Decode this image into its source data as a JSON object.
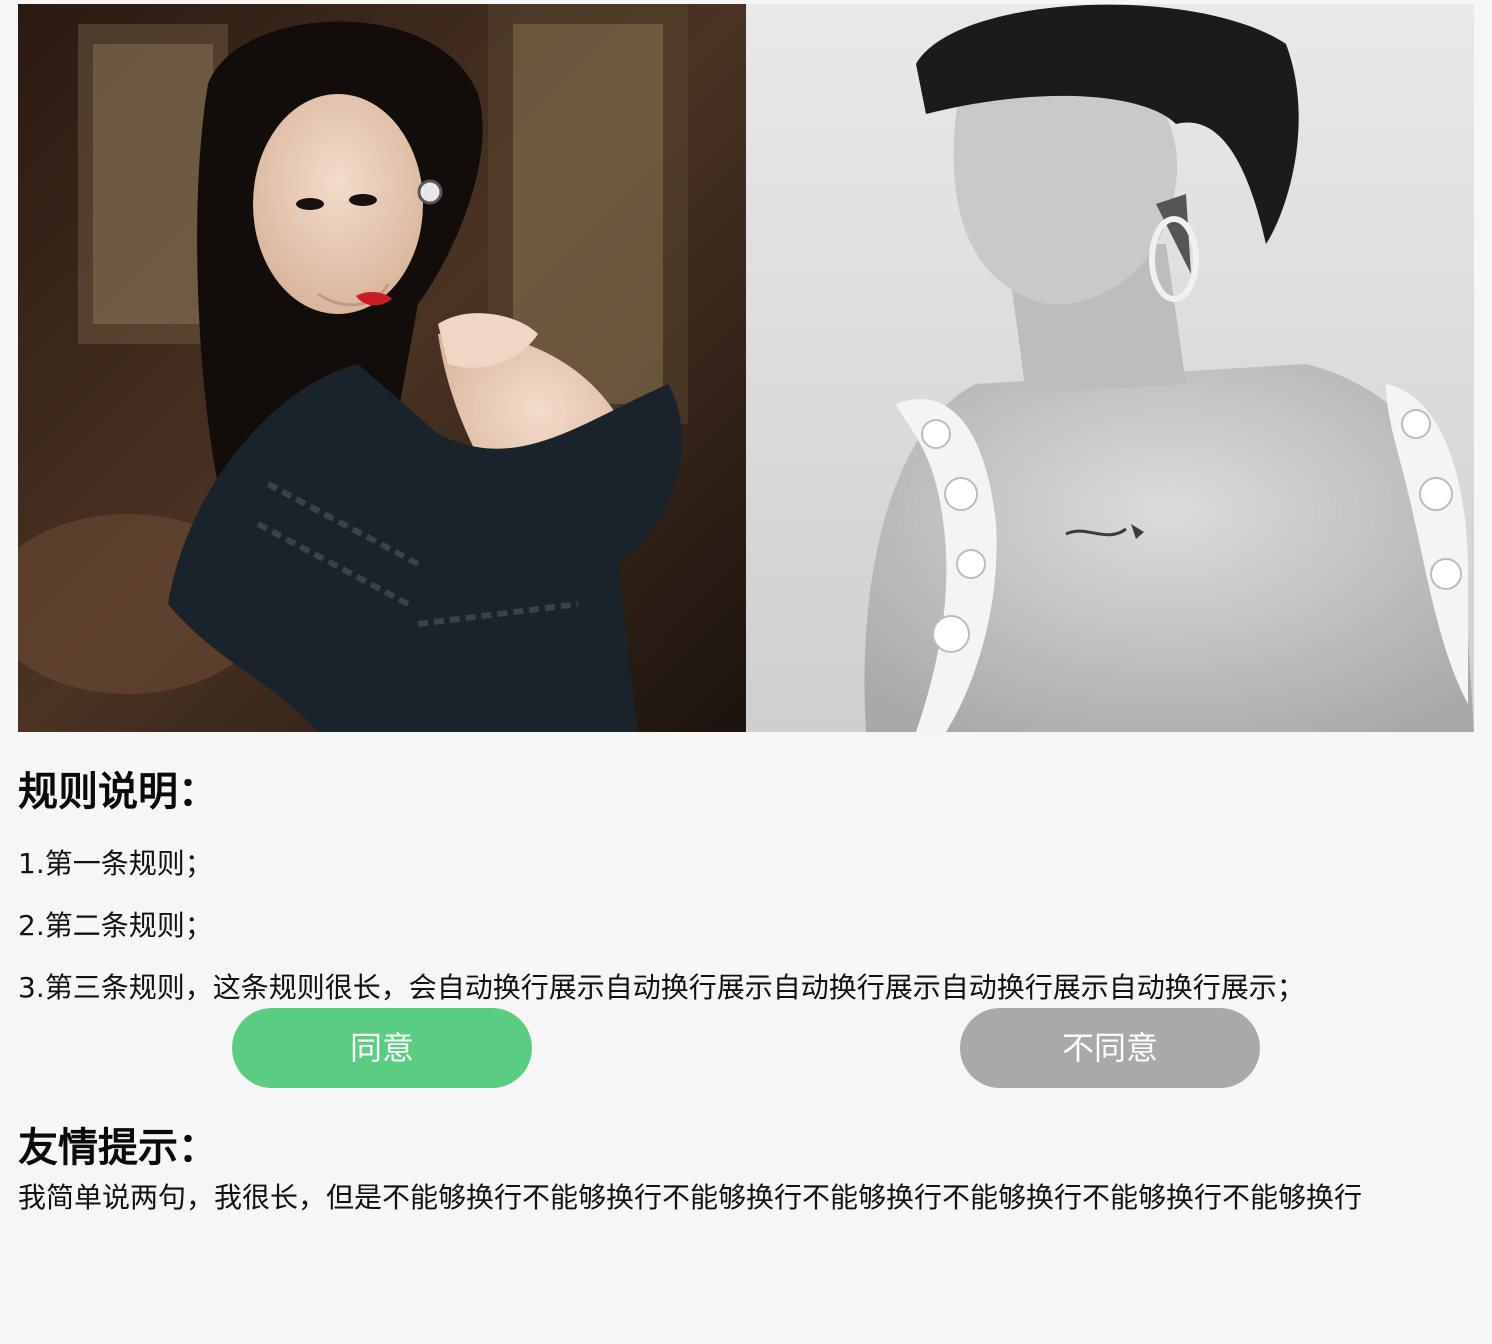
{
  "gallery": {
    "photos": [
      {
        "label": "photo-woman-black-dress",
        "tone": "color"
      },
      {
        "label": "photo-woman-lace-back",
        "tone": "grayscale"
      }
    ]
  },
  "rules": {
    "title": "规则说明：",
    "items": [
      "1.第一条规则；",
      "2.第二条规则；",
      "3.第三条规则，这条规则很长，会自动换行展示自动换行展示自动换行展示自动换行展示自动换行展示；"
    ]
  },
  "actions": {
    "agree_label": "同意",
    "disagree_label": "不同意",
    "agree_color": "#5acd82",
    "disagree_color": "#a9a9a9"
  },
  "tips": {
    "title": "友情提示：",
    "text": "我简单说两句，我很长，但是不能够换行不能够换行不能够换行不能够换行不能够换行不能够换行不能够换行"
  }
}
